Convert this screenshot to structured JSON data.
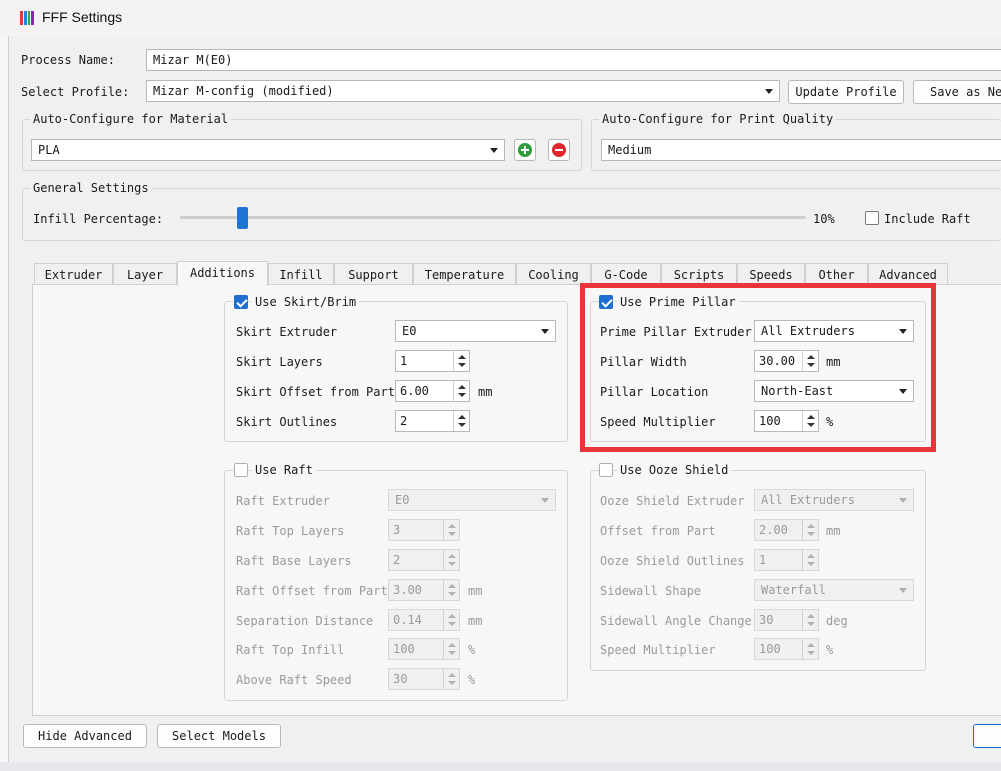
{
  "window": {
    "title": "FFF Settings",
    "icon_colors": [
      "#e53935",
      "#1e88e5",
      "#43a047",
      "#8e24aa"
    ]
  },
  "process": {
    "label": "Process Name:",
    "value": "Mizar M(E0)"
  },
  "profile": {
    "label": "Select Profile:",
    "value": "Mizar M-config (modified)",
    "update_label": "Update Profile",
    "save_as_label": "Save as New"
  },
  "auto_material": {
    "title": "Auto-Configure for Material",
    "value": "PLA"
  },
  "auto_quality": {
    "title": "Auto-Configure for Print Quality",
    "value": "Medium"
  },
  "general": {
    "title": "General Settings",
    "infill_label": "Infill Percentage:",
    "infill_value": "10%",
    "infill_fraction": 0.1,
    "include_raft_label": "Include Raft",
    "include_raft_checked": false
  },
  "tabs": [
    "Extruder",
    "Layer",
    "Additions",
    "Infill",
    "Support",
    "Temperature",
    "Cooling",
    "G-Code",
    "Scripts",
    "Speeds",
    "Other",
    "Advanced"
  ],
  "active_tab": "Additions",
  "skirt": {
    "title": "Use Skirt/Brim",
    "checked": true,
    "extruder_label": "Skirt Extruder",
    "extruder_value": "E0",
    "layers_label": "Skirt Layers",
    "layers_value": "1",
    "offset_label": "Skirt Offset from Part",
    "offset_value": "6.00",
    "offset_unit": "mm",
    "outlines_label": "Skirt Outlines",
    "outlines_value": "2"
  },
  "prime": {
    "title": "Use Prime Pillar",
    "checked": true,
    "extruder_label": "Prime Pillar Extruder",
    "extruder_value": "All Extruders",
    "width_label": "Pillar Width",
    "width_value": "30.00",
    "width_unit": "mm",
    "location_label": "Pillar Location",
    "location_value": "North-East",
    "speed_label": "Speed Multiplier",
    "speed_value": "100",
    "speed_unit": "%"
  },
  "raft": {
    "title": "Use Raft",
    "checked": false,
    "extruder_label": "Raft Extruder",
    "extruder_value": "E0",
    "top_layers_label": "Raft Top Layers",
    "top_layers_value": "3",
    "base_layers_label": "Raft Base Layers",
    "base_layers_value": "2",
    "offset_label": "Raft Offset from Part",
    "offset_value": "3.00",
    "offset_unit": "mm",
    "separation_label": "Separation Distance",
    "separation_value": "0.14",
    "separation_unit": "mm",
    "top_infill_label": "Raft Top Infill",
    "top_infill_value": "100",
    "top_infill_unit": "%",
    "above_speed_label": "Above Raft Speed",
    "above_speed_value": "30",
    "above_speed_unit": "%"
  },
  "ooze": {
    "title": "Use Ooze Shield",
    "checked": false,
    "extruder_label": "Ooze Shield Extruder",
    "extruder_value": "All Extruders",
    "offset_label": "Offset from Part",
    "offset_value": "2.00",
    "offset_unit": "mm",
    "outlines_label": "Ooze Shield Outlines",
    "outlines_value": "1",
    "sidewall_label": "Sidewall Shape",
    "sidewall_value": "Waterfall",
    "angle_label": "Sidewall Angle Change",
    "angle_value": "30",
    "angle_unit": "deg",
    "speed_label": "Speed Multiplier",
    "speed_value": "100",
    "speed_unit": "%"
  },
  "footer": {
    "hide_advanced_label": "Hide Advanced",
    "select_models_label": "Select Models"
  },
  "colors": {
    "accent": "#1f6fd1",
    "highlight": "#e8343a",
    "add": "#2e9e3a",
    "remove": "#e0262b"
  }
}
